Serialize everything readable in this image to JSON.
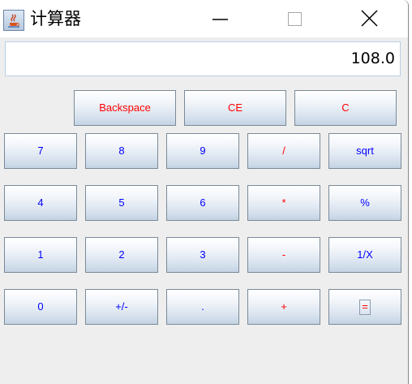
{
  "window": {
    "title": "计算器",
    "icon": "java-cup-icon",
    "controls": [
      "minimize-icon",
      "maximize-icon",
      "close-icon"
    ]
  },
  "display": {
    "value": "108.0"
  },
  "controls_row": [
    {
      "label": "Backspace"
    },
    {
      "label": "CE"
    },
    {
      "label": "C"
    }
  ],
  "keypad": [
    [
      {
        "label": "7"
      },
      {
        "label": "8"
      },
      {
        "label": "9"
      },
      {
        "label": "/"
      },
      {
        "label": "sqrt"
      }
    ],
    [
      {
        "label": "4"
      },
      {
        "label": "5"
      },
      {
        "label": "6"
      },
      {
        "label": "*"
      },
      {
        "label": "%"
      }
    ],
    [
      {
        "label": "1"
      },
      {
        "label": "2"
      },
      {
        "label": "3"
      },
      {
        "label": "-"
      },
      {
        "label": "1/X"
      }
    ],
    [
      {
        "label": "0"
      },
      {
        "label": "+/-"
      },
      {
        "label": "."
      },
      {
        "label": "+"
      },
      {
        "label": "="
      }
    ]
  ],
  "colors": {
    "digit_text": "#0000ff",
    "operator_text": "#ff0000",
    "button_border": "#7a8a99",
    "window_bg": "#eeeeee"
  }
}
